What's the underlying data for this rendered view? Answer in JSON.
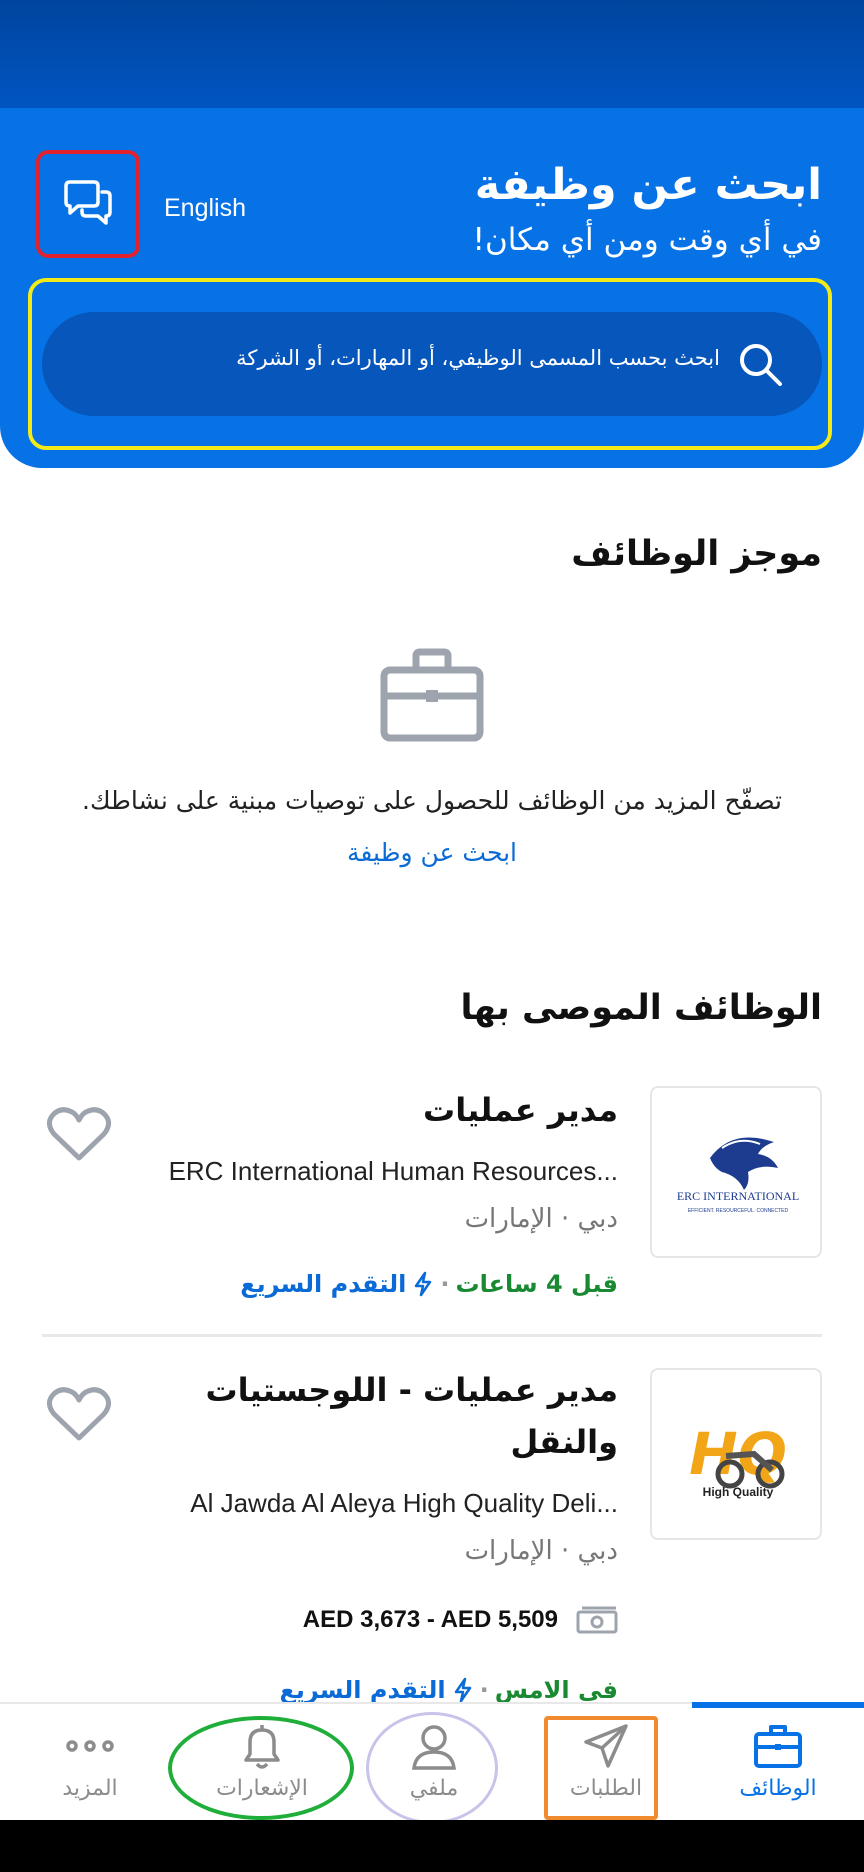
{
  "header": {
    "title": "ابحث عن وظيفة",
    "subtitle": "في أي وقت ومن أي مكان!",
    "language_link": "English",
    "search_placeholder": "ابحث بحسب المسمى الوظيفي، أو المهارات، أو الشركة"
  },
  "feed": {
    "title": "موجز الوظائف",
    "empty_message": "تصفّح المزيد من الوظائف للحصول على توصيات مبنية على نشاطك.",
    "search_link": "ابحث عن وظيفة"
  },
  "recommended": {
    "title": "الوظائف الموصى بها",
    "jobs": [
      {
        "title": "مدير عمليات",
        "company": "ERC International Human Resources...",
        "location": "دبي · الإمارات",
        "posted": "قبل 4 ساعات",
        "easy_apply": "التقدم السريع",
        "logo_text": "ERC INTERNATIONAL",
        "logo_tagline": "EFFICIENT. RESOURCEFUL. CONNECTED"
      },
      {
        "title": "مدير عمليات - اللوجستيات والنقل",
        "company": "Al Jawda Al Aleya High Quality Deli...",
        "location": "دبي · الإمارات",
        "salary": "AED 3,673 - AED 5,509",
        "posted": "في الامس",
        "easy_apply": "التقدم السريع",
        "logo_text": "HQ",
        "logo_tagline": "High Quality"
      }
    ]
  },
  "nav": {
    "jobs": "الوظائف",
    "applications": "الطلبات",
    "profile": "ملفي",
    "notifications": "الإشعارات",
    "more": "المزيد"
  },
  "colors": {
    "primary": "#0672e6",
    "header_dark": "#0656bc",
    "posted_green": "#1a8a32",
    "chat_outline": "#e0222e",
    "search_outline": "#f3ea1a",
    "applications_outline": "#f08a2c",
    "profile_outline": "#c9c2ea",
    "notifications_outline": "#1fae3a"
  }
}
